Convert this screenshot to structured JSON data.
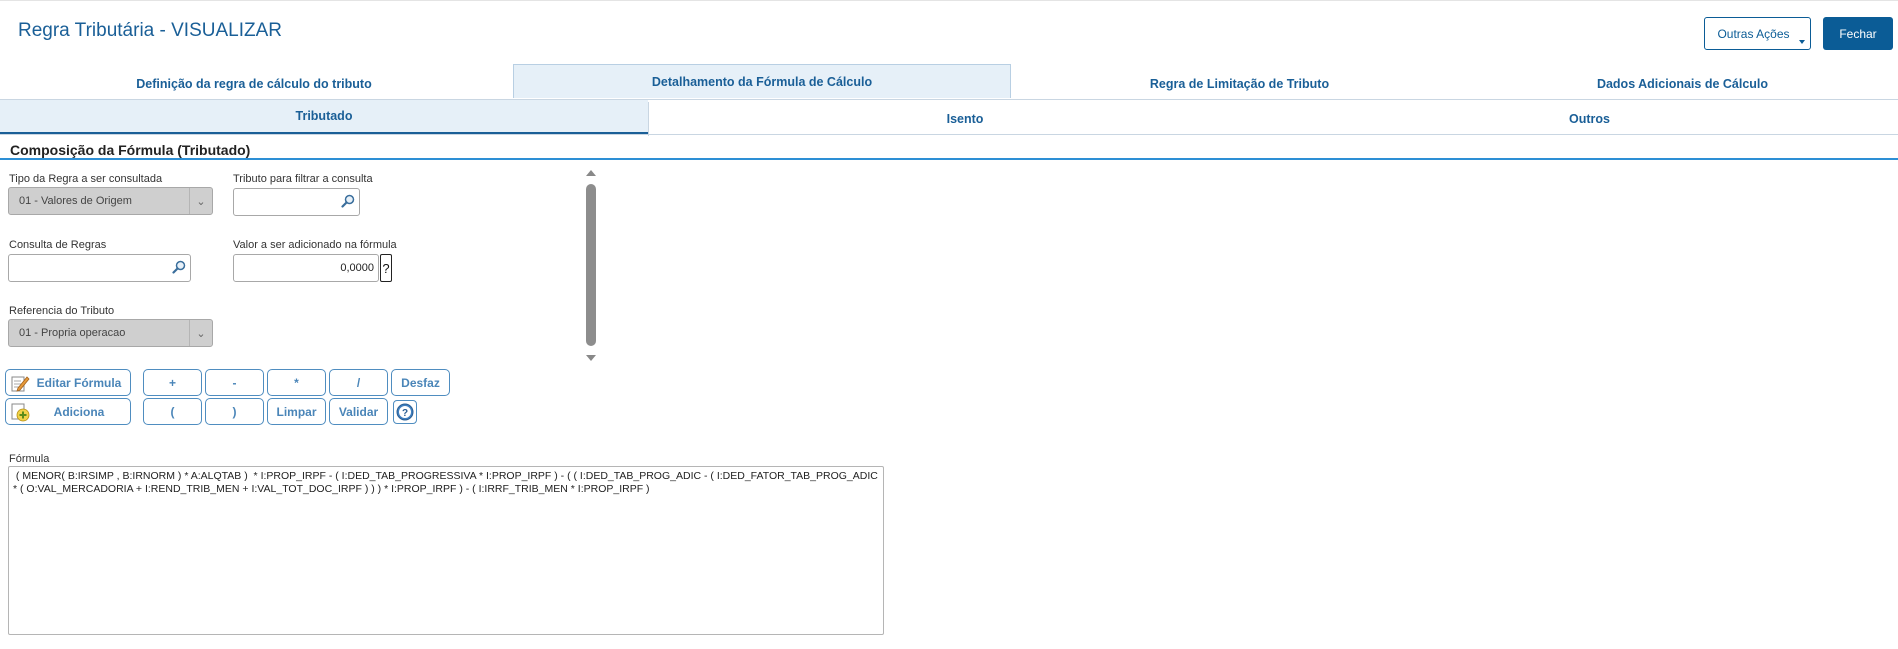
{
  "header": {
    "title": "Regra Tributária - VISUALIZAR",
    "outras_acoes": "Outras Ações",
    "fechar": "Fechar"
  },
  "main_tabs": [
    {
      "label": "Definição da regra de cálculo do tributo",
      "active": false
    },
    {
      "label": "Detalhamento da Fórmula de Cálculo",
      "active": true
    },
    {
      "label": "Regra de Limitação de Tributo",
      "active": false
    },
    {
      "label": "Dados Adicionais de Cálculo",
      "active": false
    }
  ],
  "sub_tabs": [
    {
      "label": "Tributado",
      "active": true
    },
    {
      "label": "Isento",
      "active": false
    },
    {
      "label": "Outros",
      "active": false
    }
  ],
  "section": {
    "title": "Composição da Fórmula (Tributado)"
  },
  "form": {
    "tipo_regra_label": "Tipo da Regra a ser consultada",
    "tipo_regra_value": "01 - Valores de Origem",
    "tributo_filtro_label": "Tributo para filtrar a consulta",
    "tributo_filtro_value": "",
    "consulta_regras_label": "Consulta de Regras",
    "consulta_regras_value": "",
    "valor_adicionado_label": "Valor a ser adicionado na fórmula",
    "valor_adicionado_value": "0,0000",
    "valor_help": "?",
    "referencia_label": "Referencia do Tributo",
    "referencia_value": "01 - Propria operacao"
  },
  "buttons": {
    "editar_formula": "Editar Fórmula",
    "adiciona": "Adiciona",
    "plus": "+",
    "minus": "-",
    "times": "*",
    "divide": "/",
    "desfaz": "Desfaz",
    "open_paren": "(",
    "close_paren": ")",
    "limpar": "Limpar",
    "validar": "Validar"
  },
  "formula": {
    "label": "Fórmula",
    "value": " ( MENOR( B:IRSIMP , B:IRNORM ) * A:ALQTAB )  * I:PROP_IRPF - ( I:DED_TAB_PROGRESSIVA * I:PROP_IRPF ) - ( ( I:DED_TAB_PROG_ADIC - ( I:DED_FATOR_TAB_PROG_ADIC * ( O:VAL_MERCADORIA + I:REND_TRIB_MEN + I:VAL_TOT_DOC_IRPF ) ) ) * I:PROP_IRPF ) - ( I:IRRF_TRIB_MEN * I:PROP_IRPF )"
  },
  "colors": {
    "accent": "#0b5c96",
    "tab_text": "#1a5f97",
    "section_line": "#2d8fd5"
  },
  "icons": [
    "magnifier-icon",
    "edit-formula-icon",
    "add-icon",
    "help-icon",
    "chevron-down-icon"
  ]
}
